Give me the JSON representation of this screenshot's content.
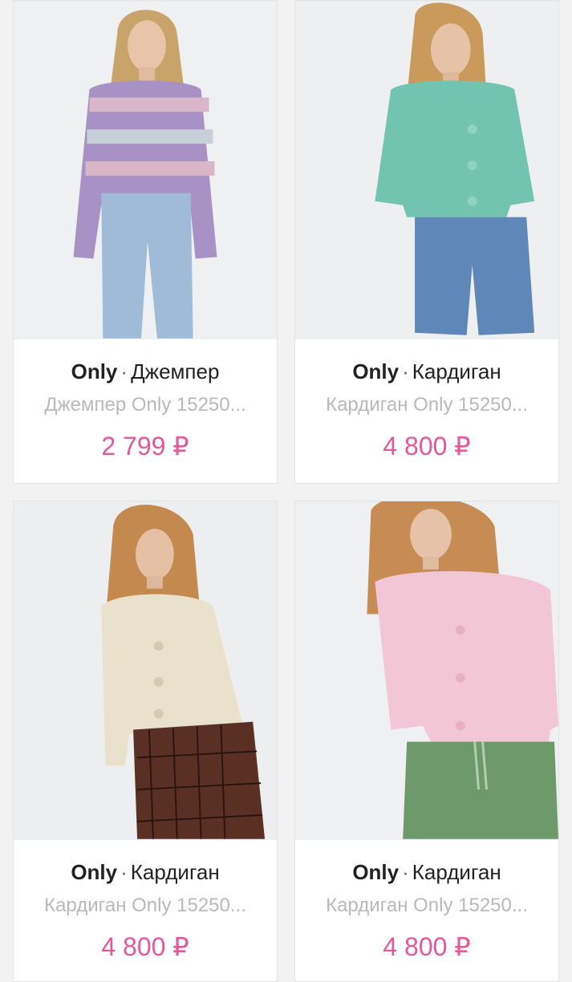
{
  "products": [
    {
      "brand": "Only",
      "separator": "·",
      "type": "Джемпер",
      "subtitle": "Джемпер Only 15250...",
      "price": "2 799 ₽",
      "image": "woman-striped-pastel-sweater-jeans"
    },
    {
      "brand": "Only",
      "separator": "·",
      "type": "Кардиган",
      "subtitle": "Кардиган Only 15250...",
      "price": "4 800 ₽",
      "image": "woman-mint-cardigan-denim-shorts"
    },
    {
      "brand": "Only",
      "separator": "·",
      "type": "Кардиган",
      "subtitle": "Кардиган Only 15250...",
      "price": "4 800 ₽",
      "image": "woman-beige-cardigan-plaid-trousers"
    },
    {
      "brand": "Only",
      "separator": "·",
      "type": "Кардиган",
      "subtitle": "Кардиган Only 15250...",
      "price": "4 800 ₽",
      "image": "woman-pink-cardigan-green-trousers"
    }
  ],
  "colors": {
    "price": "#e5589c",
    "subtitle": "#b9b9b9",
    "background": "#f2f2f2"
  }
}
